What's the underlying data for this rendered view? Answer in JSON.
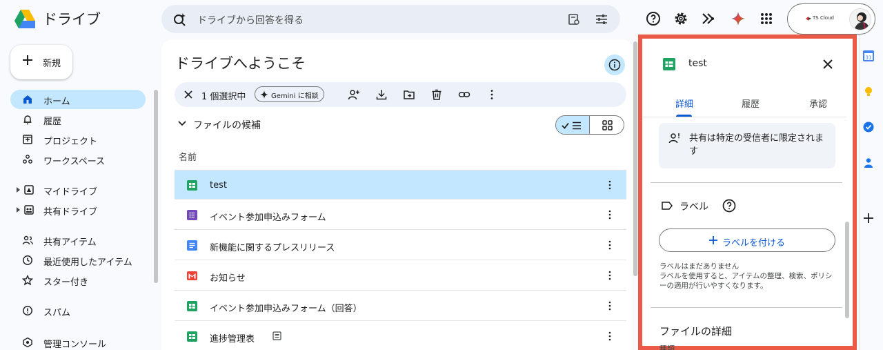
{
  "app": {
    "title": "ドライブ"
  },
  "search": {
    "placeholder": "ドライブから回答を得る"
  },
  "account": {
    "org_label": "TS Cloud"
  },
  "new_button": {
    "label": "新規"
  },
  "sidebar": {
    "items": [
      {
        "label": "ホーム",
        "icon": "home-icon",
        "active": true
      },
      {
        "label": "履歴",
        "icon": "bell-icon"
      },
      {
        "label": "プロジェクト",
        "icon": "project-icon"
      },
      {
        "label": "ワークスペース",
        "icon": "workspace-icon"
      },
      {
        "label": "マイドライブ",
        "icon": "my-drive-icon"
      },
      {
        "label": "共有ドライブ",
        "icon": "shared-drive-icon"
      },
      {
        "label": "共有アイテム",
        "icon": "people-icon"
      },
      {
        "label": "最近使用したアイテム",
        "icon": "clock-icon"
      },
      {
        "label": "スター付き",
        "icon": "star-icon"
      },
      {
        "label": "スパム",
        "icon": "spam-icon"
      },
      {
        "label": "管理コンソール",
        "icon": "admin-icon"
      }
    ]
  },
  "main": {
    "title": "ドライブへようこそ",
    "selection": {
      "count_label": "1 個選択中",
      "gemini_label": "Gemini に相談"
    },
    "section_label": "ファイルの候補",
    "column_name": "名前",
    "files": [
      {
        "name": "test",
        "type": "sheets",
        "selected": true
      },
      {
        "name": "イベント参加申込みフォーム",
        "type": "forms"
      },
      {
        "name": "新機能に関するプレスリリース",
        "type": "docs"
      },
      {
        "name": "お知らせ",
        "type": "gmail"
      },
      {
        "name": "イベント参加申込みフォーム（回答）",
        "type": "sheets"
      },
      {
        "name": "進捗管理表",
        "type": "sheets"
      }
    ]
  },
  "details": {
    "file_name": "test",
    "tabs": [
      "詳細",
      "履歴",
      "承認"
    ],
    "active_tab": "詳細",
    "share_text": "共有は特定の受信者に限定されます",
    "label_title": "ラベル",
    "add_label": "ラベルを付ける",
    "label_note": "ラベルはまだありません\nラベルを使用すると、アイテムの整理、検索、ポリシーの適用が行いやすくなります。",
    "file_details_title": "ファイルの詳細",
    "file_details_sub": "種類"
  },
  "colors": {
    "accent": "#0b57d0",
    "selected": "#c2e7ff",
    "highlight_border": "#ea5a47"
  }
}
